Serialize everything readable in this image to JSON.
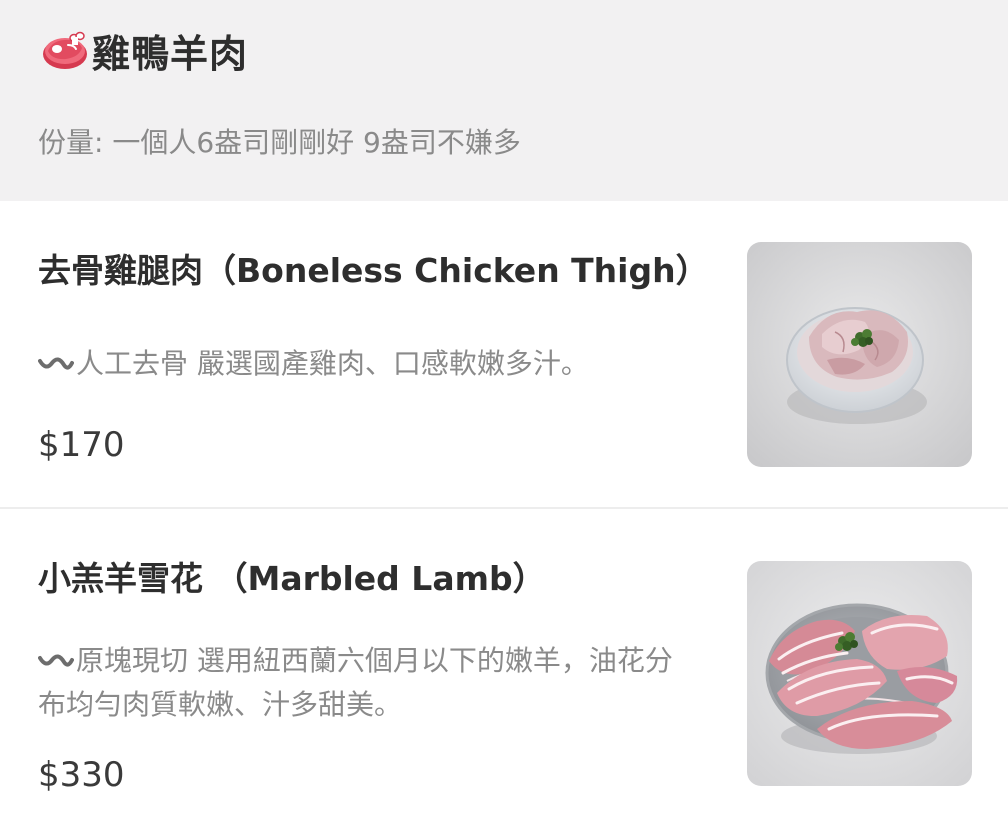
{
  "category": {
    "title": "雞鴨羊肉",
    "icon": "meat-steak-icon",
    "subtitle": "份量: 一個人6盎司剛剛好 9盎司不嫌多"
  },
  "items": [
    {
      "name": "去骨雞腿肉（Boneless Chicken Thigh）",
      "description": "人工去骨 嚴選國產雞肉、口感軟嫩多汁。",
      "price": "$170",
      "photo_icon": "chicken-thigh-photo"
    },
    {
      "name": "小羔羊雪花 （Marbled Lamb）",
      "description": "原塊現切 選用紐西蘭六個月以下的嫩羊，油花分布均勻肉質軟嫩、汁多甜美。",
      "price": "$330",
      "photo_icon": "lamb-slices-photo"
    }
  ],
  "colors": {
    "header_bg": "#f2f1f2",
    "meat_icon": "#e0435a",
    "muted_text": "#8a8a8a"
  }
}
